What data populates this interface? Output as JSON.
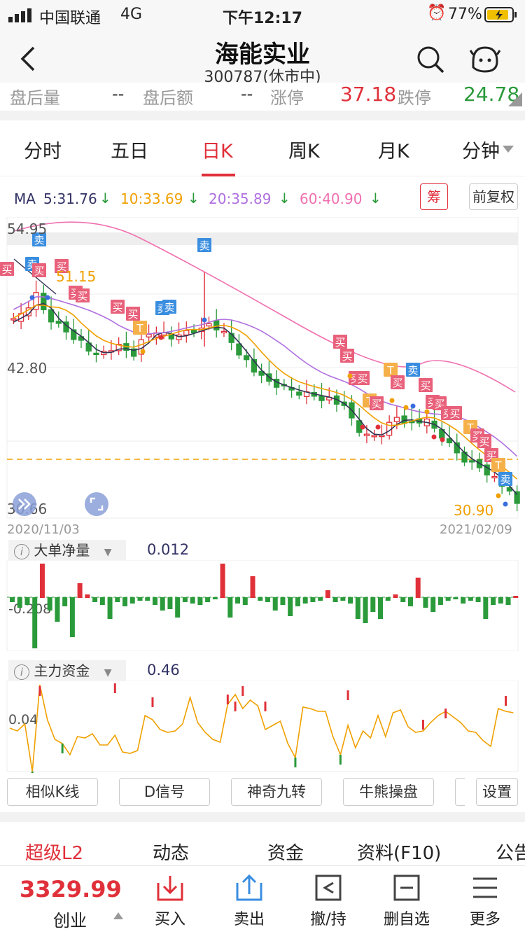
{
  "status": {
    "carrier": "中国联通",
    "network": "4G",
    "time": "下午12:17",
    "battery": "77%"
  },
  "header": {
    "title": "海能实业",
    "subtitle": "300787(休市中)"
  },
  "quote": {
    "after_hours_volume_label": "盘后量",
    "after_hours_volume_value": "--",
    "after_hours_amount_label": "盘后额",
    "after_hours_amount_value": "--",
    "limit_up_label": "涨停",
    "limit_up_value": "37.18",
    "limit_down_label": "跌停",
    "limit_down_value": "24.78"
  },
  "tabs": [
    {
      "label": "分时"
    },
    {
      "label": "五日"
    },
    {
      "label": "日K"
    },
    {
      "label": "周K"
    },
    {
      "label": "月K"
    },
    {
      "label": "分钟"
    }
  ],
  "active_tab": "日K",
  "ma": {
    "prefix": "MA",
    "ma5": "5:31.76",
    "ma10": "10:33.69",
    "ma20": "20:35.89",
    "ma60": "60:40.90",
    "chip_button": "筹",
    "adjust_button": "前复权",
    "colors": {
      "ma5": "#333355",
      "ma10": "#f0a000",
      "ma20": "#b070e0",
      "ma60": "#f070b0"
    }
  },
  "chart_data": {
    "type": "candlestick",
    "y_ticks": [
      "54.95",
      "42.80",
      "30.66"
    ],
    "high_label": "51.15",
    "low_label": "30.90",
    "x_start": "2020/11/03",
    "x_end": "2021/02/09",
    "signal_labels": {
      "buy": "买",
      "sell": "卖",
      "t": "T"
    }
  },
  "indicator1": {
    "name": "大单净量",
    "value": "0.012",
    "axis_label": "-0.208"
  },
  "indicator2": {
    "name": "主力资金",
    "value": "0.46",
    "axis_label": "0.04"
  },
  "tools": [
    {
      "label": "相似K线"
    },
    {
      "label": "D信号"
    },
    {
      "label": "神奇九转"
    },
    {
      "label": "牛熊操盘"
    },
    {
      "label": ""
    },
    {
      "label": "设置"
    }
  ],
  "bottom_tabs": [
    {
      "label": "超级L2"
    },
    {
      "label": "动态"
    },
    {
      "label": "资金"
    },
    {
      "label": "资料(F10)"
    },
    {
      "label": "公告"
    }
  ],
  "index": {
    "value": "3329.99",
    "name": "创业"
  },
  "actions": [
    {
      "label": "买入"
    },
    {
      "label": "卖出"
    },
    {
      "label": "撤/持"
    },
    {
      "label": "删自选"
    },
    {
      "label": "更多"
    }
  ],
  "colors": {
    "up": "#e0303a",
    "down": "#2a9a3a",
    "accent": "#e0303a",
    "blue": "#3a8ee0",
    "orange": "#f0a000"
  }
}
